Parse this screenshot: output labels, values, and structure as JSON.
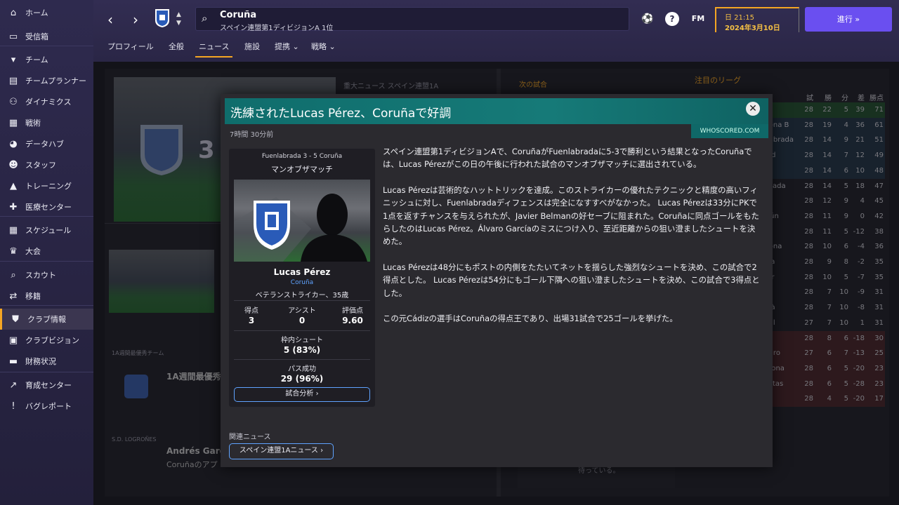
{
  "sidebar": {
    "items": [
      {
        "label": "ホーム",
        "icon": "home-icon",
        "glyph": "⌂"
      },
      {
        "label": "受信箱",
        "icon": "inbox-icon",
        "glyph": "▭"
      },
      {
        "label": "チーム",
        "icon": "shirt-icon",
        "glyph": "▾"
      },
      {
        "label": "チームプランナー",
        "icon": "clipboard-icon",
        "glyph": "▤"
      },
      {
        "label": "ダイナミクス",
        "icon": "people-icon",
        "glyph": "⚇"
      },
      {
        "label": "戦術",
        "icon": "tactics-icon",
        "glyph": "▦"
      },
      {
        "label": "データハブ",
        "icon": "data-icon",
        "glyph": "◕"
      },
      {
        "label": "スタッフ",
        "icon": "staff-icon",
        "glyph": "☻"
      },
      {
        "label": "トレーニング",
        "icon": "training-icon",
        "glyph": "▲"
      },
      {
        "label": "医療センター",
        "icon": "medical-icon",
        "glyph": "✚"
      },
      {
        "label": "スケジュール",
        "icon": "calendar-icon",
        "glyph": "▦"
      },
      {
        "label": "大会",
        "icon": "trophy-icon",
        "glyph": "♛"
      },
      {
        "label": "スカウト",
        "icon": "scout-icon",
        "glyph": "⌕"
      },
      {
        "label": "移籍",
        "icon": "transfer-icon",
        "glyph": "⇄"
      },
      {
        "label": "クラブ情報",
        "icon": "shield-icon",
        "glyph": "⛊"
      },
      {
        "label": "クラブビジョン",
        "icon": "vision-icon",
        "glyph": "▣"
      },
      {
        "label": "財務状況",
        "icon": "finance-icon",
        "glyph": "▬"
      },
      {
        "label": "育成センター",
        "icon": "growth-icon",
        "glyph": "↗"
      },
      {
        "label": "バグレポート",
        "icon": "bug-icon",
        "glyph": "!"
      }
    ]
  },
  "header": {
    "club_name": "Coruña",
    "club_sub": "スペイン連盟第1ディビジョンA 1位",
    "manager_icon_label": "FM",
    "help_label": "?",
    "time": "日 21:15",
    "date": "2024年3月10日",
    "continue_label": "進行  »",
    "tabs": [
      "プロフィール",
      "全般",
      "ニュース",
      "施設",
      "提携 ⌄",
      "戦略 ⌄"
    ]
  },
  "background": {
    "top_news_label": "重大ニュース  スペイン連盟1A",
    "next_match_label": "次の試合",
    "leagues_label": "注目のリーグ",
    "hero_score": "3",
    "team_of_week_label": "1A週間最優秀チーム",
    "team_of_week_title": "1A週間最優秀",
    "logrones_label": "S.D. LOGROÑES",
    "andres_title": "Andrés Garcí",
    "andres_sub": "Coruñaのアプ",
    "waiting_text": "待っている。",
    "table_header": [
      "試",
      "勝",
      "分",
      "差",
      "勝点"
    ],
    "table_rows": [
      {
        "club": "a",
        "p": "28",
        "w": "22",
        "d": "5",
        "gd": "39",
        "pts": "71"
      },
      {
        "club": "lona B",
        "p": "28",
        "w": "19",
        "d": "4",
        "gd": "36",
        "pts": "61"
      },
      {
        "club": "labrada",
        "p": "28",
        "w": "14",
        "d": "9",
        "gd": "21",
        "pts": "51"
      },
      {
        "club": "ad",
        "p": "28",
        "w": "14",
        "d": "7",
        "gd": "12",
        "pts": "49"
      },
      {
        "club": "l",
        "p": "28",
        "w": "14",
        "d": "6",
        "gd": "10",
        "pts": "48"
      },
      {
        "club": "rrada",
        "p": "28",
        "w": "14",
        "d": "5",
        "gd": "18",
        "pts": "47"
      },
      {
        "club": "",
        "p": "28",
        "w": "12",
        "d": "9",
        "gd": "4",
        "pts": "45"
      },
      {
        "club": "rún",
        "p": "28",
        "w": "11",
        "d": "9",
        "gd": "0",
        "pts": "42"
      },
      {
        "club": "",
        "p": "28",
        "w": "11",
        "d": "5",
        "gd": "-12",
        "pts": "38"
      },
      {
        "club": "lona",
        "p": "28",
        "w": "10",
        "d": "6",
        "gd": "-4",
        "pts": "36"
      },
      {
        "club": "sa",
        "p": "28",
        "w": "9",
        "d": "8",
        "gd": "-2",
        "pts": "35"
      },
      {
        "club": "gr",
        "p": "28",
        "w": "10",
        "d": "5",
        "gd": "-7",
        "pts": "35"
      },
      {
        "club": "",
        "p": "28",
        "w": "7",
        "d": "10",
        "gd": "-9",
        "pts": "31"
      },
      {
        "club": "llà",
        "p": "28",
        "w": "7",
        "d": "10",
        "gd": "-8",
        "pts": "31"
      },
      {
        "club": "ell",
        "p": "27",
        "w": "7",
        "d": "10",
        "gd": "1",
        "pts": "31"
      },
      {
        "club": "3",
        "p": "28",
        "w": "8",
        "d": "6",
        "gd": "-18",
        "pts": "30"
      },
      {
        "club": "eiro",
        "p": "27",
        "w": "6",
        "d": "7",
        "gd": "-13",
        "pts": "25"
      },
      {
        "club": "gona",
        "p": "28",
        "w": "6",
        "d": "5",
        "gd": "-20",
        "pts": "23"
      },
      {
        "club": "istas",
        "p": "28",
        "w": "6",
        "d": "5",
        "gd": "-28",
        "pts": "23"
      },
      {
        "club": "o",
        "p": "28",
        "w": "4",
        "d": "5",
        "gd": "-20",
        "pts": "17"
      }
    ]
  },
  "modal": {
    "title": "洗練されたLucas Pérez、Coruñaで好調",
    "close_glyph": "✕",
    "source": "WHOSCORED.COM",
    "age": "7時間 30分前",
    "card": {
      "match": "Fuenlabrada 3 - 5 Coruña",
      "award": "マンオブザマッチ",
      "player_name": "Lucas Pérez",
      "player_club": "Coruña",
      "player_role": "ベテランストライカー、35歳",
      "stats": [
        {
          "label": "得点",
          "value": "3"
        },
        {
          "label": "アシスト",
          "value": "0"
        },
        {
          "label": "評価点",
          "value": "9.60"
        }
      ],
      "shots_label": "枠内シュート",
      "shots_value": "5 (83%)",
      "pass_label": "パス成功",
      "pass_value": "29 (96%)",
      "analysis_label": "試合分析  ›"
    },
    "paragraphs": [
      "スペイン連盟第1ディビジョンAで、CoruñaがFuenlabradaに5-3で勝利という結果となったCoruñaでは、Lucas Pérezがこの日の午後に行われた試合のマンオブザマッチに選出されている。",
      "Lucas Pérezは芸術的なハットトリックを達成。このストライカーの優れたテクニックと精度の高いフィニッシュに対し、Fuenlabradaディフェンスは完全になすすべがなかった。 Lucas Pérezは33分にPKで1点を返すチャンスを与えられたが、Javier Belmanの好セーブに阻まれた。Coruñaに同点ゴールをもたらしたのはLucas Pérez。Álvaro Garcíaのミスにつけ入り、至近距離からの狙い澄ましたシュートを決めた。",
      "Lucas Pérezは48分にもポストの内側をたたいてネットを揺らした強烈なシュートを決め、この試合で2得点とした。 Lucas Pérezは54分にもゴール下隅への狙い澄ましたシュートを決め、この試合で3得点とした。",
      "この元Cádizの選手はCoruñaの得点王であり、出場31試合で25ゴールを挙げた。"
    ],
    "related_label": "関連ニュース",
    "related_button": "スペイン連盟1Aニュース ›"
  },
  "colors": {
    "accent": "#f5a623",
    "continue": "#6a4ff0",
    "modal_header": "#167a78",
    "link": "#5fa3ff"
  }
}
